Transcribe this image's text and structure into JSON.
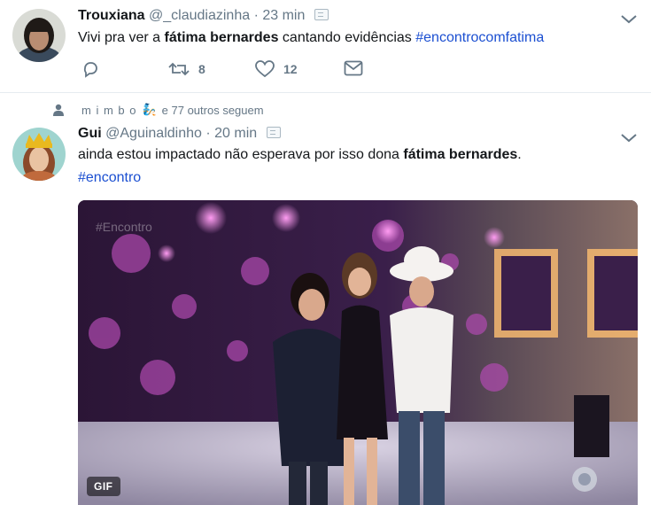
{
  "tweets": [
    {
      "name": "Trouxiana",
      "handle": "@_claudiazinha",
      "time": "23 min",
      "text_parts": {
        "pre": "Vivi pra ver a ",
        "bold": "fátima bernardes",
        "mid": " cantando evidências ",
        "hashtag": "#encontrocomfatima"
      },
      "reply_count": "",
      "retweet_count": "8",
      "like_count": "12"
    },
    {
      "context": {
        "label": "m i m b o",
        "emoji": "🧞",
        "suffix": "e 77 outros seguem"
      },
      "name": "Gui",
      "handle": "@Aguinaldinho",
      "time": "20 min",
      "text_parts": {
        "pre": "ainda estou impactado não esperava por isso dona ",
        "bold": "fátima bernardes",
        "post": ".",
        "hashtag": "#encontro"
      },
      "media": {
        "badge": "GIF",
        "watermark": "#Encontro"
      }
    }
  ],
  "colors": {
    "accent": "#1b4fd1",
    "muted": "#657786",
    "divider": "#e6ecf0"
  },
  "icons": [
    "reply-icon",
    "retweet-icon",
    "like-icon",
    "message-icon",
    "chevron-down-icon",
    "person-icon"
  ]
}
